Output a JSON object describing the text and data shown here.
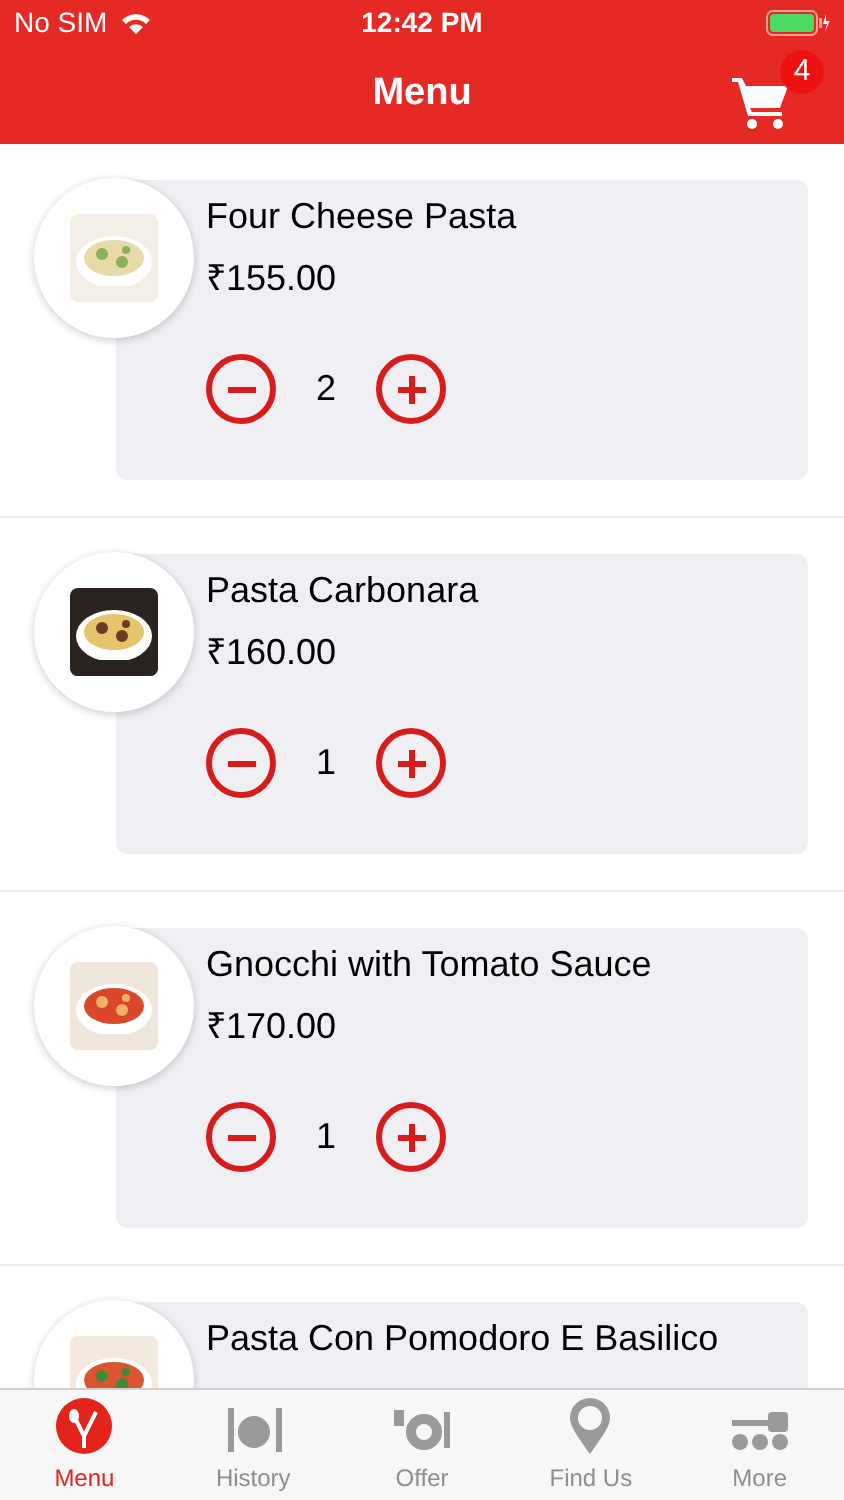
{
  "status_bar": {
    "carrier": "No SIM",
    "time": "12:42 PM"
  },
  "nav": {
    "title": "Menu",
    "cart_count": "4"
  },
  "items": [
    {
      "name": "Four Cheese Pasta",
      "price": "₹155.00",
      "quantity": "2"
    },
    {
      "name": "Pasta Carbonara",
      "price": "₹160.00",
      "quantity": "1"
    },
    {
      "name": "Gnocchi with Tomato Sauce",
      "price": "₹170.00",
      "quantity": "1"
    },
    {
      "name": "Pasta Con Pomodoro E Basilico"
    }
  ],
  "tab_bar": [
    {
      "label": "Menu",
      "kind": "menu",
      "selected": true
    },
    {
      "label": "History",
      "kind": "history",
      "selected": false
    },
    {
      "label": "Offer",
      "kind": "offer",
      "selected": false
    },
    {
      "label": "Find Us",
      "kind": "find",
      "selected": false
    },
    {
      "label": "More",
      "kind": "more",
      "selected": false
    }
  ]
}
